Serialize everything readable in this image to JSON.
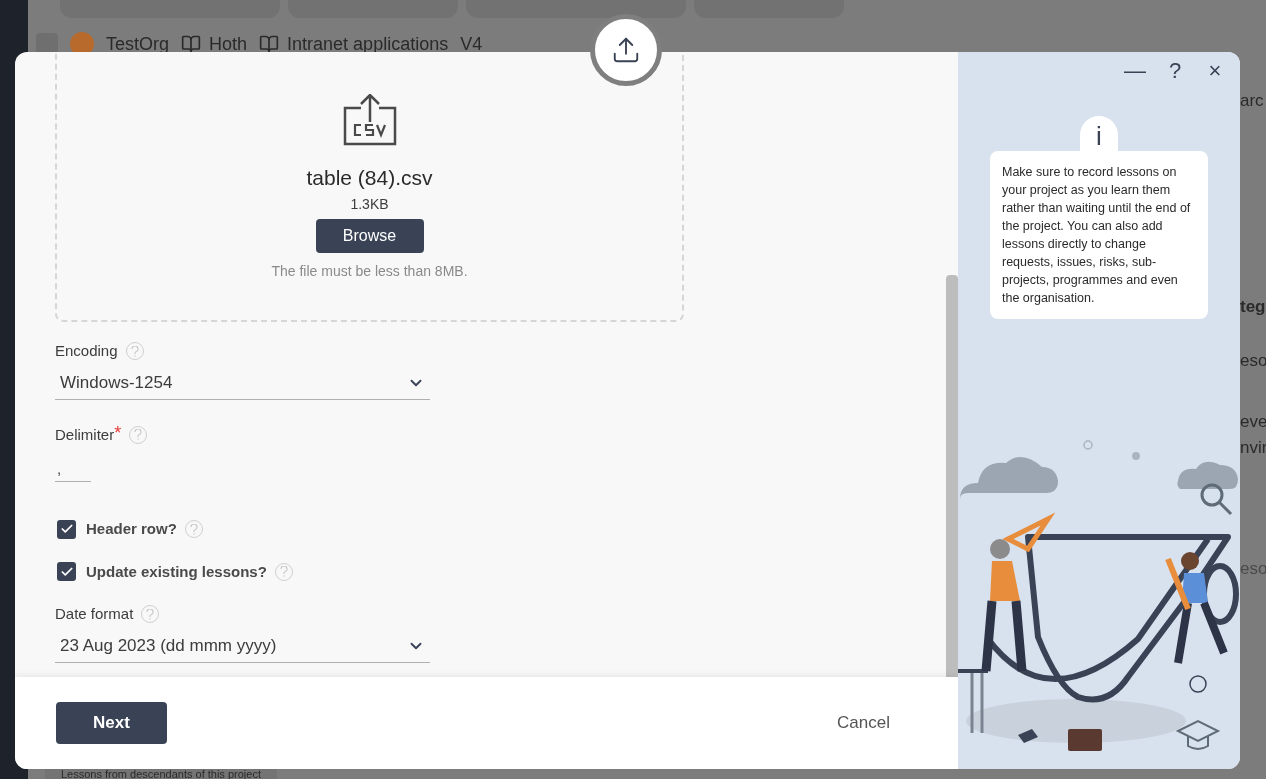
{
  "background": {
    "breadcrumb": [
      "TestOrg",
      "Hoth",
      "Intranet applications",
      "V4"
    ],
    "side_fragments": [
      "arc",
      "teg",
      "eso",
      "eve",
      "nvir",
      "eso"
    ],
    "footer_text": "Lessons from descendants of this project"
  },
  "dialog": {
    "required_mark": "*",
    "window_controls": [
      "—",
      "?",
      "×"
    ],
    "upload": {
      "file_name": "table (84).csv",
      "file_size": "1.3KB",
      "browse_label": "Browse",
      "note": "The file must be less than 8MB."
    },
    "fields": [
      {
        "kind": "select",
        "label": "Encoding",
        "required": false,
        "value": "Windows-1254"
      },
      {
        "kind": "text",
        "label": "Delimiter",
        "required": true,
        "value": ","
      },
      {
        "kind": "checkbox",
        "label": "Header row?",
        "checked": true
      },
      {
        "kind": "checkbox",
        "label": "Update existing lessons?",
        "checked": true
      },
      {
        "kind": "select",
        "label": "Date format",
        "required": false,
        "value": "23 Aug 2023 (dd mmm yyyy)"
      }
    ],
    "tip": {
      "icon": "i",
      "text": "Make sure to record lessons on your project as you learn them rather than waiting until the end of the project. You can also add lessons directly to change requests, issues, risks, sub-projects, programmes and even the organisation."
    },
    "footer": {
      "primary": "Next",
      "secondary": "Cancel"
    }
  }
}
